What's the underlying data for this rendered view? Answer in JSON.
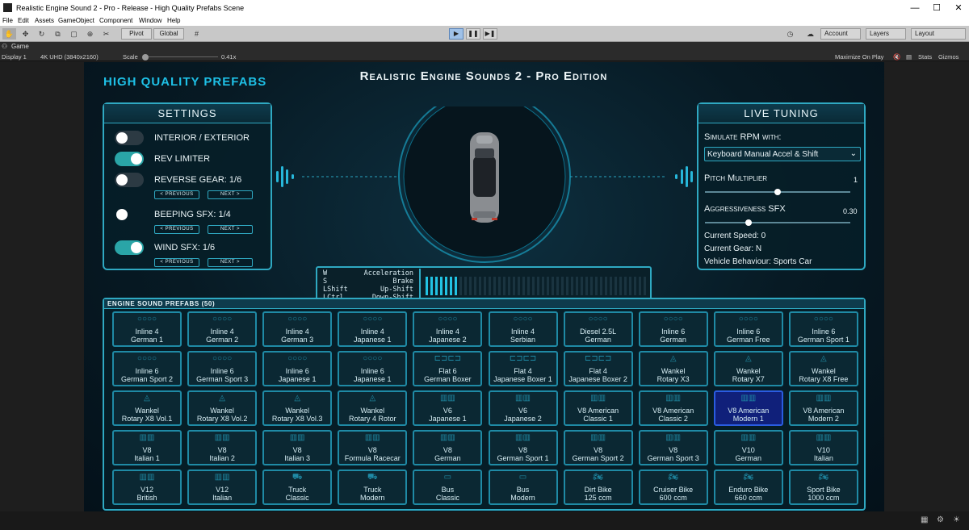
{
  "window": {
    "title": "Realistic Engine Sound 2 - Pro - Release - High Quality Prefabs Scene",
    "minimize": "—",
    "maximize": "☐",
    "close": "✕"
  },
  "menu": [
    "File",
    "Edit",
    "Assets",
    "GameObject",
    "Component",
    "Window",
    "Help"
  ],
  "toolbar": {
    "pivot": "Pivot",
    "global": "Global",
    "account": "Account",
    "layers": "Layers",
    "layout": "Layout"
  },
  "game_tab": {
    "label": "Game"
  },
  "game_bar": {
    "display": "Display 1",
    "resolution": "4K UHD (3840x2160)",
    "scale_label": "Scale",
    "scale_value": "0.41x",
    "maximize": "Maximize On Play",
    "stats": "Stats",
    "gizmos": "Gizmos"
  },
  "scene": {
    "heading": "HIGH QUALITY PREFABS",
    "title": "Realistic Engine Sounds 2 - Pro Edition",
    "settings": {
      "title": "SETTINGS",
      "prev": "< PREVIOUS",
      "next": "NEXT >",
      "items": [
        {
          "label": "INTERIOR / EXTERIOR",
          "on": false
        },
        {
          "label": "REV LIMITER",
          "on": true
        },
        {
          "label": "REVERSE GEAR: 1/6",
          "on": false
        },
        {
          "label": "BEEPING SFX: 1/4",
          "on": false
        },
        {
          "label": "WIND SFX: 1/6",
          "on": true
        }
      ]
    },
    "live": {
      "title": "LIVE TUNING",
      "simulate_label": "Simulate RPM with:",
      "simulate_value": "Keyboard Manual Accel & Shift",
      "pitch_label": "Pitch Multiplier",
      "pitch_value": "1",
      "pitch_level": 0.5,
      "aggr_label": "Aggressiveness SFX",
      "aggr_value": "0.30",
      "aggr_level": 0.3,
      "speed": "Current Speed: 0",
      "gear": "Current Gear: N",
      "behaviour": "Vehicle Behaviour: Sports Car"
    },
    "keys": {
      "k1": "W",
      "a1": "Acceleration",
      "k2": "S",
      "a2": "Brake",
      "k3": "LShift",
      "a3": "Up-Shift",
      "k4": "LCtrl",
      "a4": "Down-Shift"
    },
    "rpm_level": 0.15,
    "prefabs_title": "ENGINE SOUND PREFABS (50)",
    "prefabs": [
      [
        "Inline 4",
        "German 1"
      ],
      [
        "Inline 4",
        "German 2"
      ],
      [
        "Inline 4",
        "German 3"
      ],
      [
        "Inline 4",
        "Japanese 1"
      ],
      [
        "Inline 4",
        "Japanese 2"
      ],
      [
        "Inline 4",
        "Serbian"
      ],
      [
        "Diesel 2.5L",
        "German"
      ],
      [
        "Inline 6",
        "German"
      ],
      [
        "Inline 6",
        "German Free"
      ],
      [
        "Inline 6",
        "German Sport 1"
      ],
      [
        "Inline 6",
        "German Sport 2"
      ],
      [
        "Inline 6",
        "German Sport 3"
      ],
      [
        "Inline 6",
        "Japanese 1"
      ],
      [
        "Inline 6",
        "Japanese 1"
      ],
      [
        "Flat 6",
        "German Boxer"
      ],
      [
        "Flat 4",
        "Japanese Boxer 1"
      ],
      [
        "Flat 4",
        "Japanese Boxer 2"
      ],
      [
        "Wankel",
        "Rotary X3"
      ],
      [
        "Wankel",
        "Rotary X7"
      ],
      [
        "Wankel",
        "Rotary X8 Free"
      ],
      [
        "Wankel",
        "Rotary X8 Vol.1"
      ],
      [
        "Wankel",
        "Rotary X8 Vol.2"
      ],
      [
        "Wankel",
        "Rotary X8 Vol.3"
      ],
      [
        "Wankel",
        "Rotary 4 Rotor"
      ],
      [
        "V6",
        "Japanese 1"
      ],
      [
        "V6",
        "Japanese 2"
      ],
      [
        "V8 American",
        "Classic 1"
      ],
      [
        "V8 American",
        "Classic 2"
      ],
      [
        "V8 American",
        "Modern 1"
      ],
      [
        "V8 American",
        "Modern 2"
      ],
      [
        "V8",
        "Italian 1"
      ],
      [
        "V8",
        "Italian 2"
      ],
      [
        "V8",
        "Italian 3"
      ],
      [
        "V8",
        "Formula Racecar"
      ],
      [
        "V8",
        "German"
      ],
      [
        "V8",
        "German Sport 1"
      ],
      [
        "V8",
        "German Sport 2"
      ],
      [
        "V8",
        "German Sport 3"
      ],
      [
        "V10",
        "German"
      ],
      [
        "V10",
        "Italian"
      ],
      [
        "V12",
        "British"
      ],
      [
        "V12",
        "Italian"
      ],
      [
        "Truck",
        "Classic"
      ],
      [
        "Truck",
        "Modern"
      ],
      [
        "Bus",
        "Classic"
      ],
      [
        "Bus",
        "Modern"
      ],
      [
        "Dirt Bike",
        "125 ccm"
      ],
      [
        "Cruiser Bike",
        "600 ccm"
      ],
      [
        "Enduro Bike",
        "660 ccm"
      ],
      [
        "Sport Bike",
        "1000 ccm"
      ]
    ],
    "selected_prefab": 28
  }
}
